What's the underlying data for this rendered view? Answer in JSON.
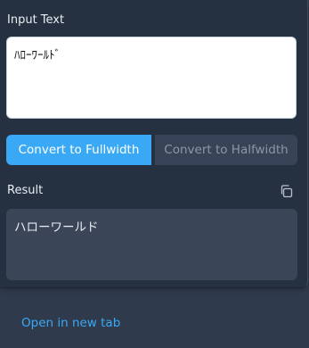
{
  "input": {
    "label": "Input Text",
    "value": "ﾊﾛｰﾜｰﾙﾄﾞ"
  },
  "convert": {
    "fullwidth_label": "Convert to Fullwidth",
    "halfwidth_label": "Convert to Halfwidth",
    "active": "fullwidth"
  },
  "result": {
    "label": "Result",
    "copy_icon": "copy-icon",
    "value": "ハローワールド"
  },
  "footer": {
    "open_link_label": "Open in new tab"
  },
  "colors": {
    "accent": "#3aa9f5",
    "panel": "#253141",
    "background": "#2f3b4c",
    "result_bg": "#3a4558"
  }
}
